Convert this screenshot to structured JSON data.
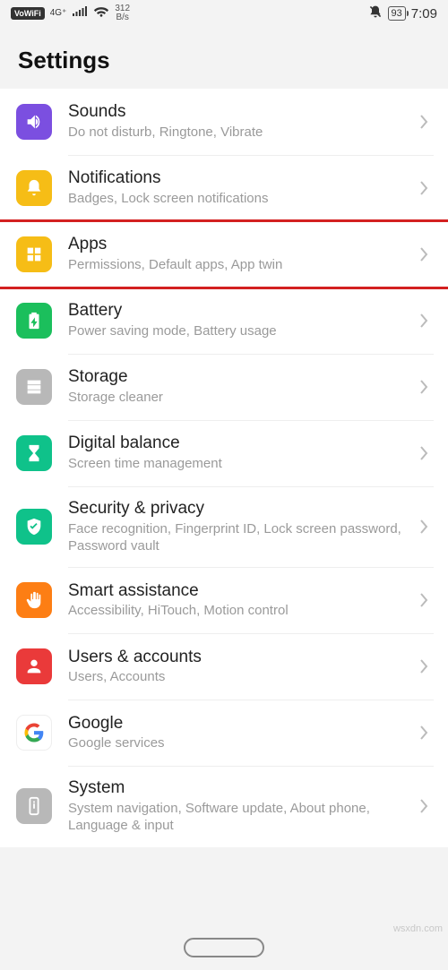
{
  "status": {
    "vowifi": "VoWiFi",
    "netgen": "4G⁺",
    "speed_num": "312",
    "speed_unit": "B/s",
    "battery": "93",
    "time": "7:09"
  },
  "header": {
    "title": "Settings"
  },
  "rows": [
    {
      "title": "Sounds",
      "sub": "Do not disturb, Ringtone, Vibrate"
    },
    {
      "title": "Notifications",
      "sub": "Badges, Lock screen notifications"
    },
    {
      "title": "Apps",
      "sub": "Permissions, Default apps, App twin"
    },
    {
      "title": "Battery",
      "sub": "Power saving mode, Battery usage"
    },
    {
      "title": "Storage",
      "sub": "Storage cleaner"
    },
    {
      "title": "Digital balance",
      "sub": "Screen time management"
    },
    {
      "title": "Security & privacy",
      "sub": "Face recognition, Fingerprint ID, Lock screen password, Password vault"
    },
    {
      "title": "Smart assistance",
      "sub": "Accessibility, HiTouch, Motion control"
    },
    {
      "title": "Users & accounts",
      "sub": "Users, Accounts"
    },
    {
      "title": "Google",
      "sub": "Google services"
    },
    {
      "title": "System",
      "sub": "System navigation, Software update, About phone, Language & input"
    }
  ],
  "watermark": "wsxdn.com"
}
